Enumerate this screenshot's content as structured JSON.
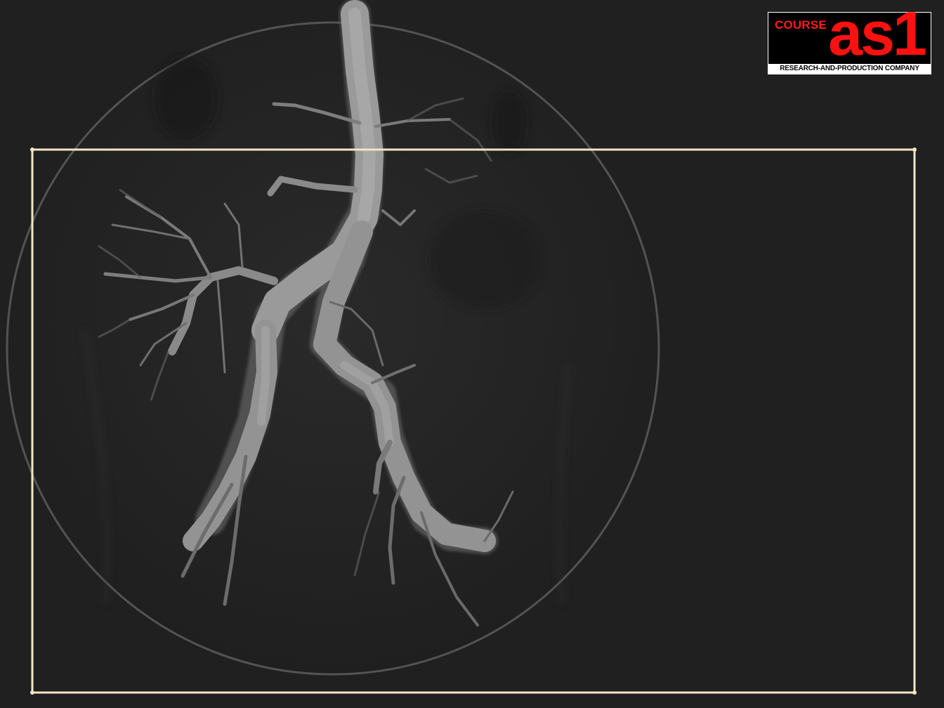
{
  "image": {
    "subject": "aortic angiogram",
    "colors": {
      "background": "#202020",
      "field": "#252525",
      "vessel": "#9a9a9a",
      "frame": "#f3e6c4"
    }
  },
  "logo": {
    "course": "COURSE",
    "mark": "as1",
    "strapline": "RESEARCH-AND-PRODUCTION COMPANY",
    "colors": {
      "text": "#ff1111",
      "box": "#000000",
      "strap": "#ffffff"
    }
  }
}
